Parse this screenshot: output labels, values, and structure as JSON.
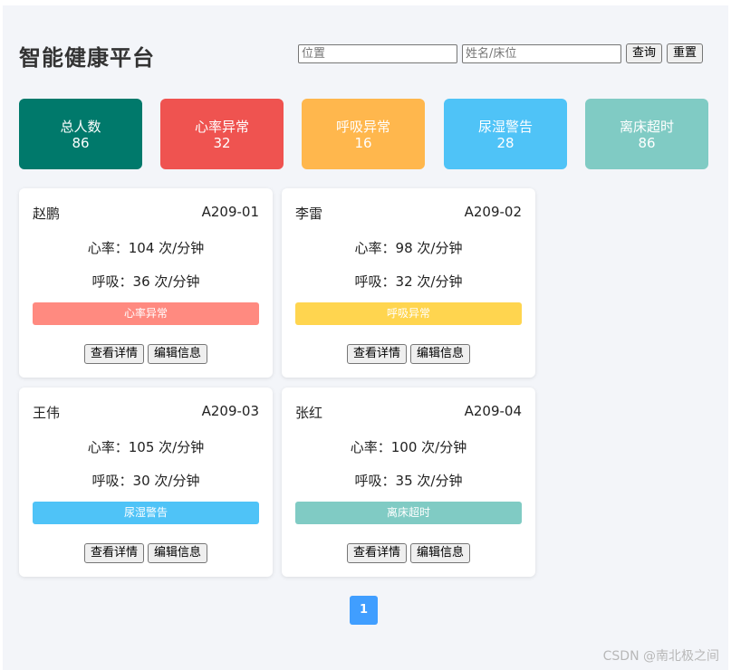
{
  "app": {
    "title": "智能健康平台"
  },
  "search": {
    "location_placeholder": "位置",
    "name_placeholder": "姓名/床位",
    "query_label": "查询",
    "reset_label": "重置"
  },
  "stats": [
    {
      "label": "总人数",
      "value": "86",
      "color": "#00796b"
    },
    {
      "label": "心率异常",
      "value": "32",
      "color": "#ef5350"
    },
    {
      "label": "呼吸异常",
      "value": "16",
      "color": "#ffb74d"
    },
    {
      "label": "尿湿警告",
      "value": "28",
      "color": "#4fc3f7"
    },
    {
      "label": "离床超时",
      "value": "86",
      "color": "#80cbc4"
    }
  ],
  "patients": [
    {
      "name": "赵鹏",
      "bed": "A209-01",
      "heart_rate": "心率：104 次/分钟",
      "breath": "呼吸：36 次/分钟",
      "status": "心率异常",
      "status_color": "#ff8a80"
    },
    {
      "name": "李雷",
      "bed": "A209-02",
      "heart_rate": "心率：98 次/分钟",
      "breath": "呼吸：32 次/分钟",
      "status": "呼吸异常",
      "status_color": "#ffd54f"
    },
    {
      "name": "王伟",
      "bed": "A209-03",
      "heart_rate": "心率：105 次/分钟",
      "breath": "呼吸：30 次/分钟",
      "status": "尿湿警告",
      "status_color": "#4fc3f7"
    },
    {
      "name": "张红",
      "bed": "A209-04",
      "heart_rate": "心率：100 次/分钟",
      "breath": "呼吸：35 次/分钟",
      "status": "离床超时",
      "status_color": "#80cbc4"
    }
  ],
  "card_actions": {
    "detail_label": "查看详情",
    "edit_label": "编辑信息"
  },
  "pagination": {
    "current_page": "1"
  },
  "watermark": "CSDN @南北极之间"
}
